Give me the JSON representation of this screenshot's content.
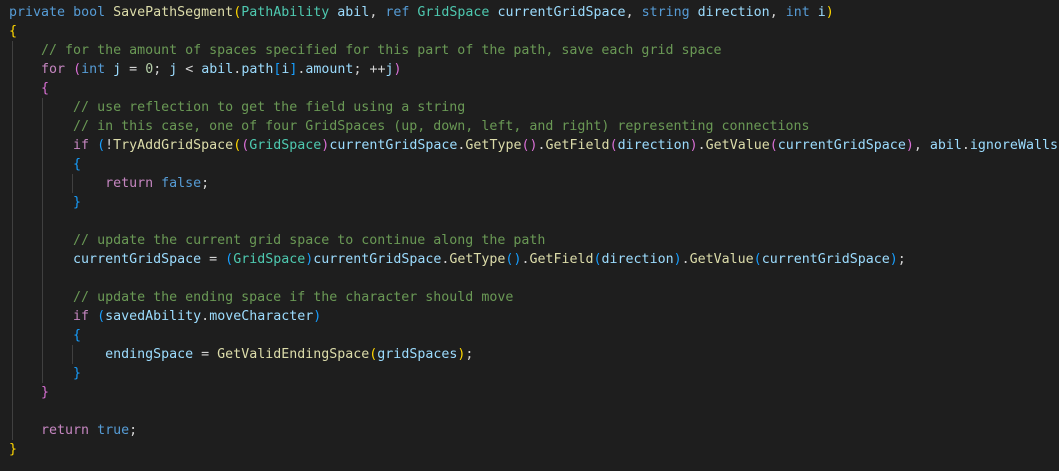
{
  "editor": {
    "language": "csharp",
    "colors": {
      "background": "#1e1e1e",
      "text": "#d4d4d4",
      "keyword": "#569cd6",
      "control": "#c586c0",
      "type": "#4ec9b0",
      "variable": "#9cdcfe",
      "function": "#dcdcaa",
      "number": "#b5cea8",
      "comment": "#6a9955",
      "bracket_1": "#ffd700",
      "bracket_2": "#da70d6",
      "bracket_3": "#179fff",
      "indent_guide": "#404040"
    },
    "lines": [
      {
        "indent": 0,
        "tokens": [
          {
            "t": "private",
            "k": "kw"
          },
          {
            "t": " ",
            "k": "punct"
          },
          {
            "t": "bool",
            "k": "kw"
          },
          {
            "t": " ",
            "k": "punct"
          },
          {
            "t": "SavePathSegment",
            "k": "fn"
          },
          {
            "t": "(",
            "k": "b1"
          },
          {
            "t": "PathAbility",
            "k": "type"
          },
          {
            "t": " ",
            "k": "punct"
          },
          {
            "t": "abil",
            "k": "var"
          },
          {
            "t": ", ",
            "k": "punct"
          },
          {
            "t": "ref",
            "k": "kw"
          },
          {
            "t": " ",
            "k": "punct"
          },
          {
            "t": "GridSpace",
            "k": "type"
          },
          {
            "t": " ",
            "k": "punct"
          },
          {
            "t": "currentGridSpace",
            "k": "var"
          },
          {
            "t": ", ",
            "k": "punct"
          },
          {
            "t": "string",
            "k": "kw"
          },
          {
            "t": " ",
            "k": "punct"
          },
          {
            "t": "direction",
            "k": "var"
          },
          {
            "t": ", ",
            "k": "punct"
          },
          {
            "t": "int",
            "k": "kw"
          },
          {
            "t": " ",
            "k": "punct"
          },
          {
            "t": "i",
            "k": "var"
          },
          {
            "t": ")",
            "k": "b1"
          }
        ]
      },
      {
        "indent": 0,
        "tokens": [
          {
            "t": "{",
            "k": "b1"
          }
        ]
      },
      {
        "indent": 1,
        "tokens": [
          {
            "t": "// for the amount of spaces specified for this part of the path, save each grid space",
            "k": "comment"
          }
        ]
      },
      {
        "indent": 1,
        "tokens": [
          {
            "t": "for",
            "k": "ctl"
          },
          {
            "t": " ",
            "k": "punct"
          },
          {
            "t": "(",
            "k": "b2"
          },
          {
            "t": "int",
            "k": "kw"
          },
          {
            "t": " ",
            "k": "punct"
          },
          {
            "t": "j",
            "k": "var"
          },
          {
            "t": " = ",
            "k": "punct"
          },
          {
            "t": "0",
            "k": "num"
          },
          {
            "t": "; ",
            "k": "punct"
          },
          {
            "t": "j",
            "k": "var"
          },
          {
            "t": " < ",
            "k": "punct"
          },
          {
            "t": "abil",
            "k": "var"
          },
          {
            "t": ".",
            "k": "punct"
          },
          {
            "t": "path",
            "k": "var"
          },
          {
            "t": "[",
            "k": "b3"
          },
          {
            "t": "i",
            "k": "var"
          },
          {
            "t": "]",
            "k": "b3"
          },
          {
            "t": ".",
            "k": "punct"
          },
          {
            "t": "amount",
            "k": "var"
          },
          {
            "t": "; ++",
            "k": "punct"
          },
          {
            "t": "j",
            "k": "var"
          },
          {
            "t": ")",
            "k": "b2"
          }
        ]
      },
      {
        "indent": 1,
        "tokens": [
          {
            "t": "{",
            "k": "b2"
          }
        ]
      },
      {
        "indent": 2,
        "tokens": [
          {
            "t": "// use reflection to get the field using a string",
            "k": "comment"
          }
        ]
      },
      {
        "indent": 2,
        "tokens": [
          {
            "t": "// in this case, one of four GridSpaces (up, down, left, and right) representing connections",
            "k": "comment"
          }
        ]
      },
      {
        "indent": 2,
        "tokens": [
          {
            "t": "if",
            "k": "ctl"
          },
          {
            "t": " ",
            "k": "punct"
          },
          {
            "t": "(",
            "k": "b3"
          },
          {
            "t": "!",
            "k": "punct"
          },
          {
            "t": "TryAddGridSpace",
            "k": "fn"
          },
          {
            "t": "(",
            "k": "b1"
          },
          {
            "t": "(",
            "k": "b2"
          },
          {
            "t": "GridSpace",
            "k": "type"
          },
          {
            "t": ")",
            "k": "b2"
          },
          {
            "t": "currentGridSpace",
            "k": "var"
          },
          {
            "t": ".",
            "k": "punct"
          },
          {
            "t": "GetType",
            "k": "fn"
          },
          {
            "t": "(",
            "k": "b2"
          },
          {
            "t": ")",
            "k": "b2"
          },
          {
            "t": ".",
            "k": "punct"
          },
          {
            "t": "GetField",
            "k": "fn"
          },
          {
            "t": "(",
            "k": "b2"
          },
          {
            "t": "direction",
            "k": "var"
          },
          {
            "t": ")",
            "k": "b2"
          },
          {
            "t": ".",
            "k": "punct"
          },
          {
            "t": "GetValue",
            "k": "fn"
          },
          {
            "t": "(",
            "k": "b2"
          },
          {
            "t": "currentGridSpace",
            "k": "var"
          },
          {
            "t": ")",
            "k": "b2"
          },
          {
            "t": ", ",
            "k": "punct"
          },
          {
            "t": "abil",
            "k": "var"
          },
          {
            "t": ".",
            "k": "punct"
          },
          {
            "t": "ignoreWalls",
            "k": "var"
          },
          {
            "t": ")",
            "k": "b1"
          },
          {
            "t": ")",
            "k": "b3"
          }
        ]
      },
      {
        "indent": 2,
        "tokens": [
          {
            "t": "{",
            "k": "b3"
          }
        ]
      },
      {
        "indent": 3,
        "tokens": [
          {
            "t": "return",
            "k": "ctl"
          },
          {
            "t": " ",
            "k": "punct"
          },
          {
            "t": "false",
            "k": "kw"
          },
          {
            "t": ";",
            "k": "punct"
          }
        ]
      },
      {
        "indent": 2,
        "tokens": [
          {
            "t": "}",
            "k": "b3"
          }
        ]
      },
      {
        "indent": 2,
        "tokens": []
      },
      {
        "indent": 2,
        "tokens": [
          {
            "t": "// update the current grid space to continue along the path",
            "k": "comment"
          }
        ]
      },
      {
        "indent": 2,
        "tokens": [
          {
            "t": "currentGridSpace",
            "k": "var"
          },
          {
            "t": " = ",
            "k": "punct"
          },
          {
            "t": "(",
            "k": "b3"
          },
          {
            "t": "GridSpace",
            "k": "type"
          },
          {
            "t": ")",
            "k": "b3"
          },
          {
            "t": "currentGridSpace",
            "k": "var"
          },
          {
            "t": ".",
            "k": "punct"
          },
          {
            "t": "GetType",
            "k": "fn"
          },
          {
            "t": "(",
            "k": "b3"
          },
          {
            "t": ")",
            "k": "b3"
          },
          {
            "t": ".",
            "k": "punct"
          },
          {
            "t": "GetField",
            "k": "fn"
          },
          {
            "t": "(",
            "k": "b3"
          },
          {
            "t": "direction",
            "k": "var"
          },
          {
            "t": ")",
            "k": "b3"
          },
          {
            "t": ".",
            "k": "punct"
          },
          {
            "t": "GetValue",
            "k": "fn"
          },
          {
            "t": "(",
            "k": "b3"
          },
          {
            "t": "currentGridSpace",
            "k": "var"
          },
          {
            "t": ")",
            "k": "b3"
          },
          {
            "t": ";",
            "k": "punct"
          }
        ]
      },
      {
        "indent": 2,
        "tokens": []
      },
      {
        "indent": 2,
        "tokens": [
          {
            "t": "// update the ending space if the character should move",
            "k": "comment"
          }
        ]
      },
      {
        "indent": 2,
        "tokens": [
          {
            "t": "if",
            "k": "ctl"
          },
          {
            "t": " ",
            "k": "punct"
          },
          {
            "t": "(",
            "k": "b3"
          },
          {
            "t": "savedAbility",
            "k": "var"
          },
          {
            "t": ".",
            "k": "punct"
          },
          {
            "t": "moveCharacter",
            "k": "var"
          },
          {
            "t": ")",
            "k": "b3"
          }
        ]
      },
      {
        "indent": 2,
        "tokens": [
          {
            "t": "{",
            "k": "b3"
          }
        ]
      },
      {
        "indent": 3,
        "tokens": [
          {
            "t": "endingSpace",
            "k": "var"
          },
          {
            "t": " = ",
            "k": "punct"
          },
          {
            "t": "GetValidEndingSpace",
            "k": "fn"
          },
          {
            "t": "(",
            "k": "b1"
          },
          {
            "t": "gridSpaces",
            "k": "var"
          },
          {
            "t": ")",
            "k": "b1"
          },
          {
            "t": ";",
            "k": "punct"
          }
        ]
      },
      {
        "indent": 2,
        "tokens": [
          {
            "t": "}",
            "k": "b3"
          }
        ]
      },
      {
        "indent": 1,
        "tokens": [
          {
            "t": "}",
            "k": "b2"
          }
        ]
      },
      {
        "indent": 1,
        "tokens": []
      },
      {
        "indent": 1,
        "tokens": [
          {
            "t": "return",
            "k": "ctl"
          },
          {
            "t": " ",
            "k": "punct"
          },
          {
            "t": "true",
            "k": "kw"
          },
          {
            "t": ";",
            "k": "punct"
          }
        ]
      },
      {
        "indent": 0,
        "tokens": [
          {
            "t": "}",
            "k": "b1"
          }
        ]
      }
    ]
  }
}
